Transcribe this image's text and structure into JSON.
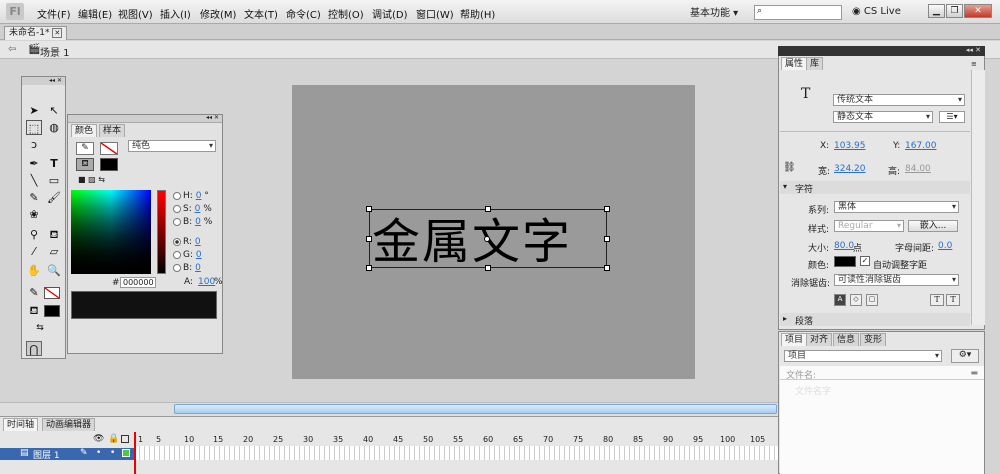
{
  "menubar": {
    "logo": "Fl",
    "items": [
      "文件(F)",
      "编辑(E)",
      "视图(V)",
      "插入(I)",
      "修改(M)",
      "文本(T)",
      "命令(C)",
      "控制(O)",
      "调试(D)",
      "窗口(W)",
      "帮助(H)"
    ],
    "workspace": "基本功能",
    "cslive": "CS Live"
  },
  "doc_tab": {
    "title": "未命名-1*"
  },
  "scene": {
    "label": "场景 1"
  },
  "stage": {
    "text": "金属文字",
    "bg_color": "#9a9a9a"
  },
  "color_panel": {
    "tabs": [
      "颜色",
      "样本"
    ],
    "fill_type": "纯色",
    "hsb": [
      {
        "label": "H:",
        "value": "0",
        "unit": "°"
      },
      {
        "label": "S:",
        "value": "0",
        "unit": "%"
      },
      {
        "label": "B:",
        "value": "0",
        "unit": "%"
      }
    ],
    "rgb": [
      {
        "label": "R:",
        "value": "0"
      },
      {
        "label": "G:",
        "value": "0"
      },
      {
        "label": "B:",
        "value": "0"
      }
    ],
    "hex_label": "#",
    "hex_value": "000000",
    "alpha_label": "A:",
    "alpha_value": "100",
    "alpha_unit": "%"
  },
  "props": {
    "tabs": [
      "属性",
      "库"
    ],
    "text_type": "传统文本",
    "text_mode": "静态文本",
    "x_label": "X:",
    "x_value": "103.95",
    "y_label": "Y:",
    "y_value": "167.00",
    "w_label": "宽:",
    "w_value": "324.20",
    "h_label": "高:",
    "h_value": "84.00",
    "section_char": "字符",
    "family_label": "系列:",
    "family_value": "黑体",
    "style_label": "样式:",
    "style_value": "Regular",
    "embed_label": "嵌入...",
    "size_label": "大小:",
    "size_value": "80.0",
    "size_unit": "点",
    "spacing_label": "字母间距:",
    "spacing_value": "0.0",
    "color_label": "颜色:",
    "autokern_label": "自动调整字距",
    "aa_label": "消除锯齿:",
    "aa_value": "可读性消除锯齿",
    "section_para": "段落",
    "t_icon": "T"
  },
  "library": {
    "tabs": [
      "项目",
      "对齐",
      "信息",
      "变形"
    ],
    "dropdown": "项目",
    "file_label": "文件名:",
    "item_label": "文件名字"
  },
  "timeline": {
    "tabs": [
      "时间轴",
      "动画编辑器"
    ],
    "frame_numbers": [
      "1",
      "5",
      "10",
      "15",
      "20",
      "25",
      "30",
      "35",
      "40",
      "45",
      "50",
      "55",
      "60",
      "65",
      "70",
      "75",
      "80",
      "85",
      "90",
      "95",
      "100",
      "105"
    ],
    "layer_name": "图层 1"
  },
  "colors": {
    "accent": "#2a6fc9",
    "selection": "#3a68b0"
  }
}
